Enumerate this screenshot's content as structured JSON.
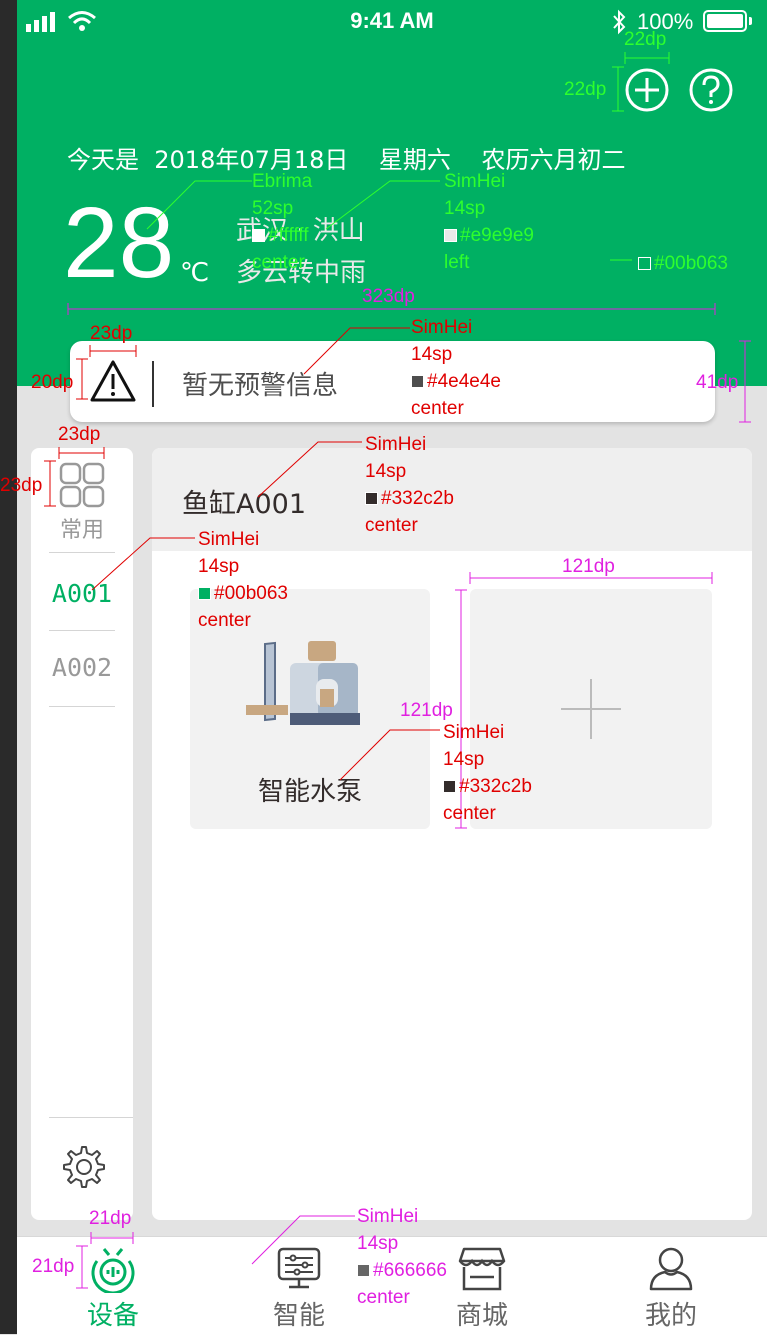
{
  "status_bar": {
    "time": "9:41 AM",
    "battery": "100%"
  },
  "header": {
    "date_line": "今天是  2018年07月18日    星期六    农历六月初二",
    "temperature": "28",
    "temperature_unit": "℃",
    "location": "武汉 · 洪山",
    "weather": "多云转中雨",
    "add_icon": "plus-circle-icon",
    "help_icon": "question-circle-icon"
  },
  "warning": {
    "icon": "warning-icon",
    "text": "暂无预警信息"
  },
  "sidebar": {
    "common_label": "常用",
    "tabs": [
      {
        "label": "A001",
        "active": true
      },
      {
        "label": "A002",
        "active": false
      }
    ],
    "settings_icon": "gear-icon"
  },
  "main": {
    "group_title": "鱼缸A001",
    "devices": [
      {
        "name": "智能水泵",
        "icon": "water-pump-image"
      }
    ],
    "add_icon": "plus-icon"
  },
  "nav": {
    "items": [
      {
        "label": "设备",
        "icon": "device-icon",
        "active": true
      },
      {
        "label": "智能",
        "icon": "smart-icon",
        "active": false
      },
      {
        "label": "商城",
        "icon": "store-icon",
        "active": false
      },
      {
        "label": "我的",
        "icon": "profile-icon",
        "active": false
      }
    ]
  },
  "colors": {
    "primary": "#00b063",
    "header_text": "#e9e9e9",
    "warning_text": "#4e4e4e",
    "title_text": "#332c2b",
    "nav_text": "#666666",
    "page_bg": "#e3e3e3"
  },
  "annotations": {
    "temp_font": "Ebrima",
    "temp_size": "52sp",
    "temp_color": "#ffffff",
    "temp_align": "center",
    "city_font": "SimHei",
    "city_size": "14sp",
    "city_color": "#e9e9e9",
    "city_align": "left",
    "header_color": "#00b063",
    "dim_add_w": "22dp",
    "dim_add_h": "22dp",
    "dim_card_w": "323dp",
    "dim_card_h": "41dp",
    "dim_warn_w": "23dp",
    "dim_warn_h": "20dp",
    "warn_font": "SimHei",
    "warn_size": "14sp",
    "warn_color": "#4e4e4e",
    "warn_align": "center",
    "dim_common_w": "23dp",
    "dim_common_h": "23dp",
    "group_font": "SimHei",
    "group_size": "14sp",
    "group_color": "#332c2b",
    "group_align": "center",
    "tab_font": "SimHei",
    "tab_size": "14sp",
    "tab_color": "#00b063",
    "tab_align": "center",
    "dim_tile_w": "121dp",
    "dim_tile_h": "121dp",
    "device_font": "SimHei",
    "device_size": "14sp",
    "device_color": "#332c2b",
    "device_align": "center",
    "dim_nav_w": "21dp",
    "dim_nav_h": "21dp",
    "nav_font": "SimHei",
    "nav_size": "14sp",
    "nav_color": "#666666",
    "nav_align": "center"
  }
}
